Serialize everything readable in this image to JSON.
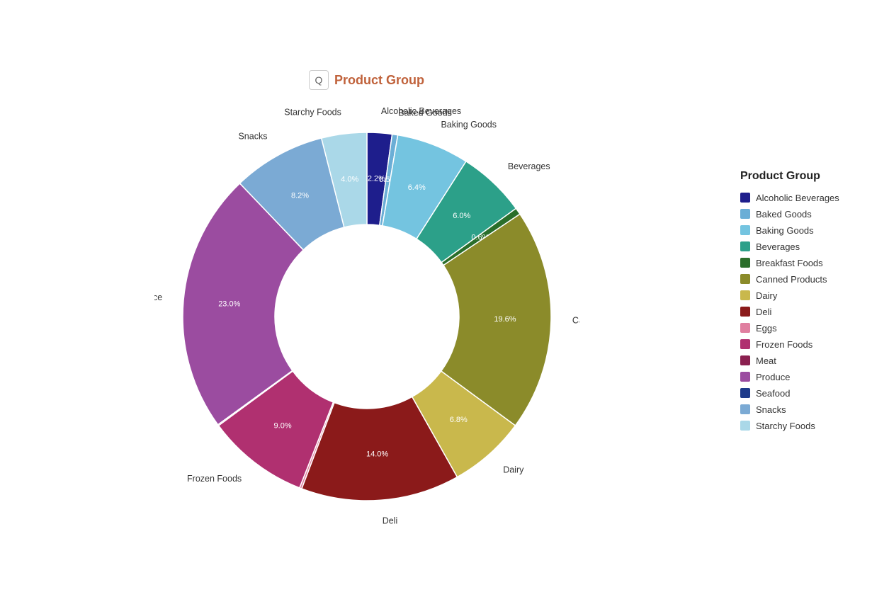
{
  "title": {
    "icon": "🔍",
    "label": "Product Group"
  },
  "legend": {
    "title": "Product Group",
    "items": [
      {
        "label": "Alcoholic Beverages",
        "color": "#1e1e8c"
      },
      {
        "label": "Baked Goods",
        "color": "#6baed6"
      },
      {
        "label": "Baking Goods",
        "color": "#74c4e0"
      },
      {
        "label": "Beverages",
        "color": "#2ca089"
      },
      {
        "label": "Breakfast Foods",
        "color": "#2a6e2a"
      },
      {
        "label": "Canned Products",
        "color": "#8b8b2a"
      },
      {
        "label": "Dairy",
        "color": "#c9b84c"
      },
      {
        "label": "Deli",
        "color": "#8b1a1a"
      },
      {
        "label": "Eggs",
        "color": "#e07fa0"
      },
      {
        "label": "Frozen Foods",
        "color": "#b03070"
      },
      {
        "label": "Meat",
        "color": "#8b2050"
      },
      {
        "label": "Produce",
        "color": "#9b4ca0"
      },
      {
        "label": "Seafood",
        "color": "#1e3a8a"
      },
      {
        "label": "Snacks",
        "color": "#7baad4"
      },
      {
        "label": "Starchy Foods",
        "color": "#aad8e8"
      }
    ]
  },
  "segments": [
    {
      "label": "Alcoholic Beverages",
      "value": 2.2,
      "color": "#1e1e8c"
    },
    {
      "label": "Baked Goods",
      "color": "#6baed6",
      "value": 0.5
    },
    {
      "label": "Baking Goods",
      "value": 6.4,
      "color": "#74c4e0"
    },
    {
      "label": "Beverages",
      "value": 6.0,
      "color": "#2ca089"
    },
    {
      "label": "Breakfast Foods",
      "value": 0.6,
      "color": "#2a6e2a"
    },
    {
      "label": "Canned Products",
      "value": 19.6,
      "color": "#8b8b2a"
    },
    {
      "label": "Dairy",
      "value": 6.8,
      "color": "#c9b84c"
    },
    {
      "label": "Deli",
      "value": 14.0,
      "color": "#8b1a1a"
    },
    {
      "label": "Eggs",
      "value": 0.2,
      "color": "#e07fa0"
    },
    {
      "label": "Frozen Foods",
      "value": 9.0,
      "color": "#b03070"
    },
    {
      "label": "Meat",
      "value": 0.1,
      "color": "#8b2050"
    },
    {
      "label": "Produce",
      "value": 23.0,
      "color": "#9b4ca0"
    },
    {
      "label": "Seafood",
      "value": 0.0,
      "color": "#1e3a8a"
    },
    {
      "label": "Snacks",
      "value": 8.2,
      "color": "#7baad4"
    },
    {
      "label": "Starchy Foods",
      "value": 4.0,
      "color": "#aad8e8"
    }
  ]
}
